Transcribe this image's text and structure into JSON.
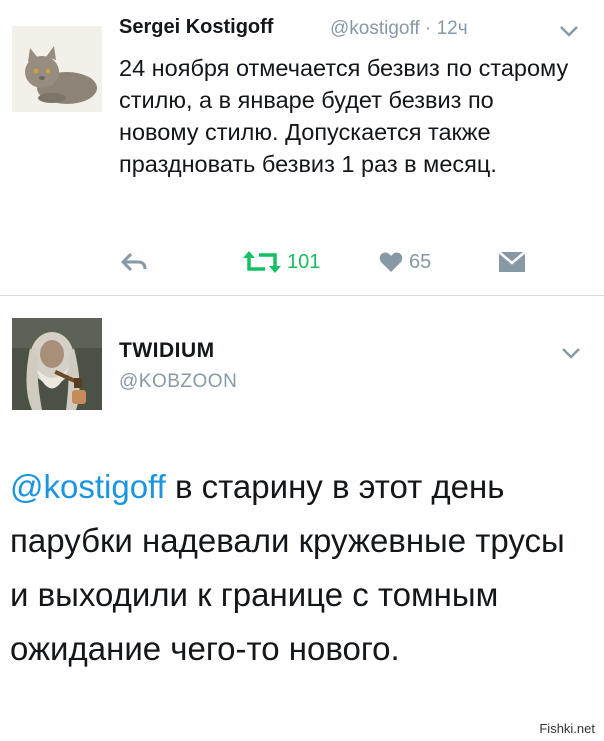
{
  "tweet1": {
    "author_name": "Sergei Kostigoff",
    "handle": "@kostigoff",
    "separator": "·",
    "time": "12ч",
    "text": "24 ноября отмечается безвиз по старому стилю, а в январе будет безвиз по новому стилю. Допускается также праздновать безвиз 1 раз в месяц.",
    "retweet_count": "101",
    "like_count": "65",
    "icons": {
      "reply": "reply-icon",
      "retweet": "retweet-icon",
      "like": "heart-icon",
      "dm": "envelope-icon",
      "menu": "chevron-down-icon"
    },
    "colors": {
      "retweet_active": "#17bf63",
      "icon_gray": "#8899a6"
    }
  },
  "tweet2": {
    "author_name": "TWIDIUM",
    "handle": "@KOBZOON",
    "mention": "@kostigoff",
    "text": " в старину в этот день парубки надевали кружевные трусы и выходили к границе с томным  ожидание чего-то нового.",
    "colors": {
      "mention": "#1b95e0"
    }
  },
  "watermark": "Fishki.net"
}
